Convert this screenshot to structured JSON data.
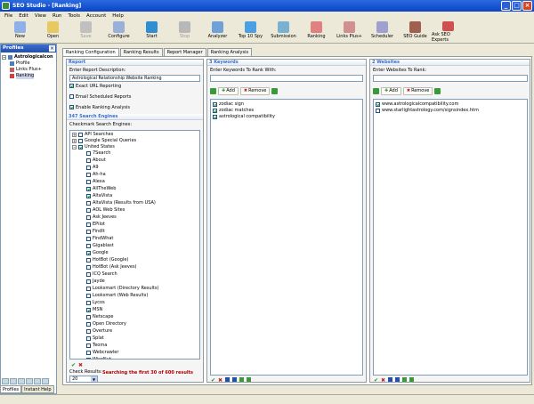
{
  "window": {
    "title": "SEO Studio - [Ranking]"
  },
  "menu": [
    "File",
    "Edit",
    "View",
    "Run",
    "Tools",
    "Account",
    "Help"
  ],
  "toolbar": [
    {
      "label": "New",
      "icon": "new-icon",
      "color": "#8fb0e8"
    },
    {
      "label": "Open",
      "icon": "open-folder-icon",
      "color": "#e8c860"
    },
    {
      "label": "Save",
      "icon": "save-icon",
      "color": "#c0c0c0",
      "disabled": true
    },
    {
      "label": "Configure",
      "icon": "configure-icon",
      "color": "#9ab0d8"
    },
    {
      "label": "Start",
      "icon": "start-icon",
      "color": "#2f8fd0"
    },
    {
      "label": "Stop",
      "icon": "stop-icon",
      "color": "#b8b8b8",
      "disabled": true
    },
    {
      "label": "Analyzer",
      "icon": "analyzer-icon",
      "color": "#6fa0d8"
    },
    {
      "label": "Top 10 Spy",
      "icon": "spy-icon",
      "color": "#4aa0e0"
    },
    {
      "label": "Submission",
      "icon": "submission-icon",
      "color": "#7ab0d0"
    },
    {
      "label": "Ranking",
      "icon": "ranking-icon",
      "color": "#e08080"
    },
    {
      "label": "Links Plus+",
      "icon": "links-icon",
      "color": "#d09090"
    },
    {
      "label": "Scheduler",
      "icon": "scheduler-icon",
      "color": "#a0a0d0"
    },
    {
      "label": "SEO Guide",
      "icon": "guide-icon",
      "color": "#a06050"
    },
    {
      "label": "Ask SEO Experts",
      "icon": "experts-icon",
      "color": "#d05050"
    }
  ],
  "left_panel": {
    "title": "Profiles",
    "tree": [
      {
        "label": "Astrologicalcon",
        "level": 0,
        "bold": true
      },
      {
        "label": "Profile",
        "level": 1
      },
      {
        "label": "Links Plus+",
        "level": 1
      },
      {
        "label": "Ranking",
        "level": 1,
        "selected": true
      }
    ],
    "tabs": [
      "Profiles",
      "Instant Help"
    ]
  },
  "tabs": [
    "Ranking Configuration",
    "Ranking Results",
    "Report Manager",
    "Ranking Analysis"
  ],
  "report": {
    "header": "Report",
    "desc_label": "Enter Report Description:",
    "desc_value": "Astrological Relationship Website Ranking",
    "options": [
      {
        "label": "Exact URL Reporting",
        "checked": true
      },
      {
        "label": "Email Scheduled Reports",
        "checked": false
      },
      {
        "label": "Enable Ranking Analysis",
        "checked": true
      }
    ]
  },
  "engines": {
    "header": "347 Search Engines",
    "label": "Checkmark Search Engines:",
    "groups": [
      {
        "label": "API Searches",
        "expanded": false
      },
      {
        "label": "Google Special Queries",
        "expanded": false
      },
      {
        "label": "United States",
        "expanded": true,
        "checked": true
      }
    ],
    "items": [
      {
        "label": "7Search",
        "checked": false
      },
      {
        "label": "About",
        "checked": false
      },
      {
        "label": "A9",
        "checked": false
      },
      {
        "label": "Ah-ha",
        "checked": false
      },
      {
        "label": "Alexa",
        "checked": false
      },
      {
        "label": "AllTheWeb",
        "checked": true
      },
      {
        "label": "AltaVista",
        "checked": true
      },
      {
        "label": "AltaVista (Results from USA)",
        "checked": false
      },
      {
        "label": "AOL Web Sites",
        "checked": false
      },
      {
        "label": "Ask Jeeves",
        "checked": false
      },
      {
        "label": "EPilot",
        "checked": false
      },
      {
        "label": "FindIt",
        "checked": false
      },
      {
        "label": "FindWhat",
        "checked": false
      },
      {
        "label": "Gigablast",
        "checked": false
      },
      {
        "label": "Google",
        "checked": true
      },
      {
        "label": "HotBot (Google)",
        "checked": false
      },
      {
        "label": "HotBot (Ask Jeeves)",
        "checked": false
      },
      {
        "label": "ICQ Search",
        "checked": false
      },
      {
        "label": "Jayde",
        "checked": false
      },
      {
        "label": "Looksmart (Directory Results)",
        "checked": false
      },
      {
        "label": "Looksmart (Web Results)",
        "checked": false
      },
      {
        "label": "Lycos",
        "checked": false
      },
      {
        "label": "MSN",
        "checked": true
      },
      {
        "label": "Netscape",
        "checked": false
      },
      {
        "label": "Open Directory",
        "checked": false
      },
      {
        "label": "Overture",
        "checked": false
      },
      {
        "label": "Splat",
        "checked": false
      },
      {
        "label": "Teoma",
        "checked": false
      },
      {
        "label": "Webcrawler",
        "checked": false
      },
      {
        "label": "WiseNut",
        "checked": false
      },
      {
        "label": "Yahoo!",
        "checked": true
      }
    ],
    "check_results_label": "Check Results:",
    "check_results_value": "20",
    "status": "Searching the first 30 of 600 results"
  },
  "keywords": {
    "header": "3 Keywords",
    "label": "Enter Keywords To Rank With:",
    "add": "Add",
    "remove": "Remove",
    "items": [
      {
        "label": "zodiac sign",
        "checked": true
      },
      {
        "label": "zodiac matches",
        "checked": true
      },
      {
        "label": "astrological compatibility",
        "checked": true
      }
    ]
  },
  "websites": {
    "header": "2 Websites",
    "label": "Enter Websites To Rank:",
    "add": "Add",
    "remove": "Remove",
    "items": [
      {
        "label": "www.astrologicalcompatibility.com",
        "checked": true
      },
      {
        "label": "www.starlightastrology.com/signsindex.htm",
        "checked": false
      }
    ]
  }
}
